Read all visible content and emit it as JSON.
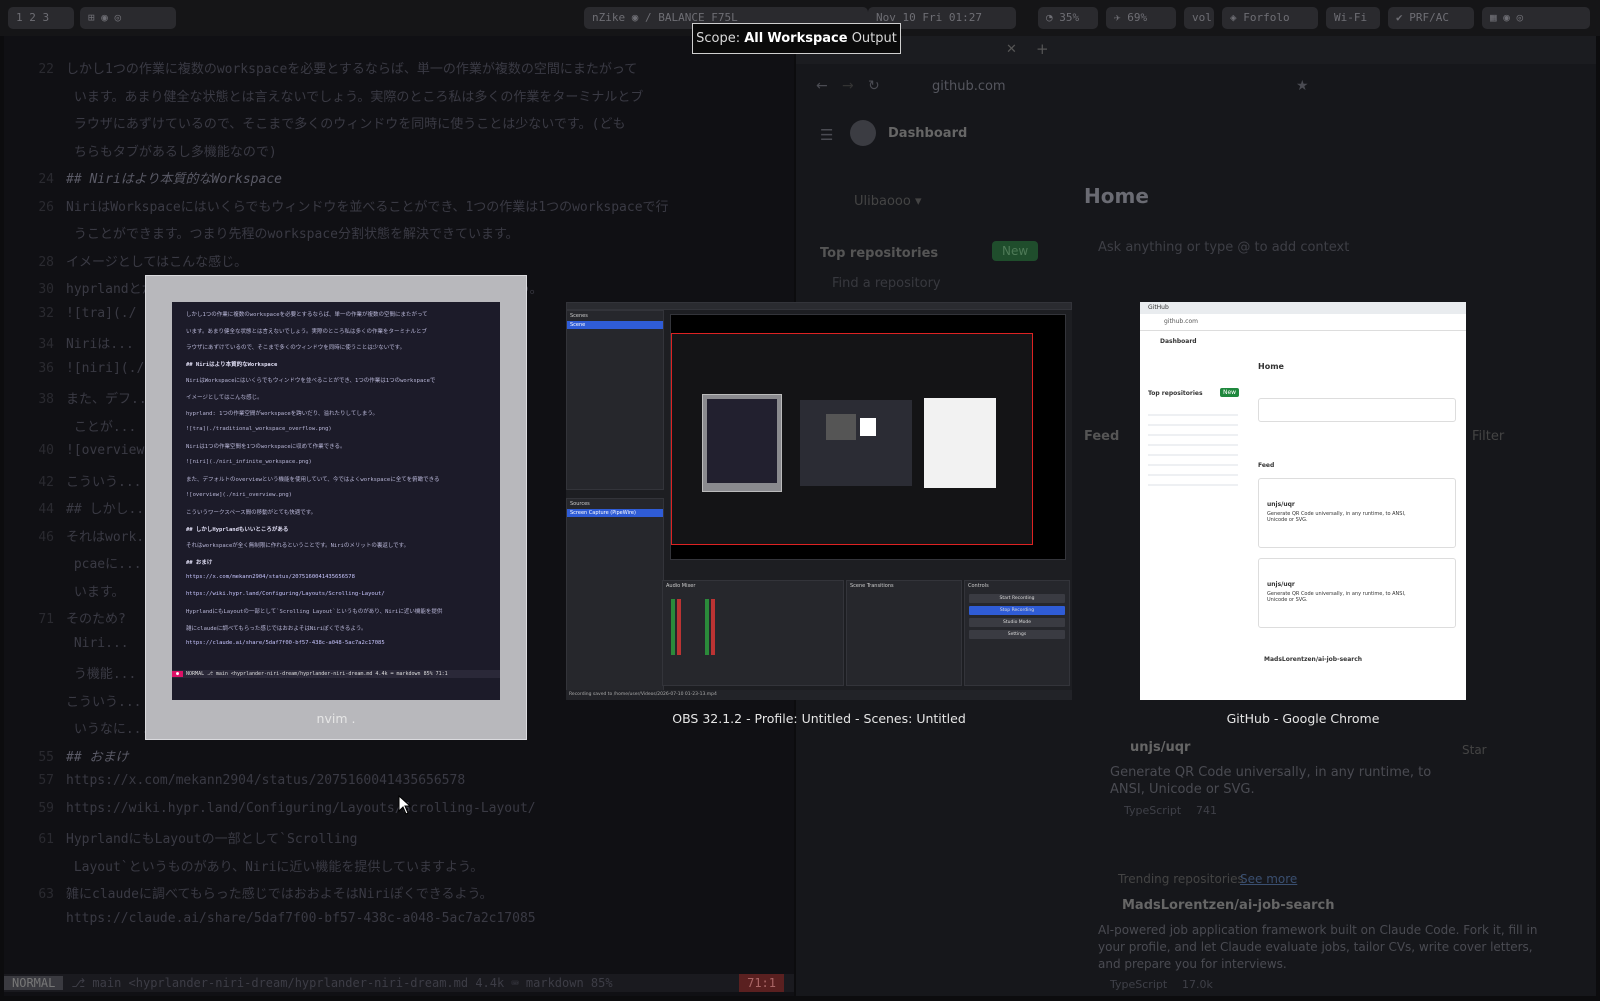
{
  "topbar": {
    "pills": [
      "1 2 3",
      "⊞ ◉ ◎",
      "nZike ◉ / BALANCE F75L",
      "Nov 10 Fri 01:27",
      "◔ 35%",
      "✈ 69%",
      "vol",
      "◈ Forfolo",
      "Wi-Fi",
      "✔ PRF/AC",
      "▦ ◉ ◎"
    ]
  },
  "scope": {
    "label": "Scope:",
    "all": "All",
    "workspace": "Workspace",
    "output": "Output"
  },
  "editor": {
    "lines": [
      {
        "n": "22",
        "t": "しかし1つの作業に複数のworkspaceを必要とするならば、単一の作業が複数の空間にまたがって"
      },
      {
        "n": "",
        "t": "  います。あまり健全な状態とは言えないでしょう。実際のところ私は多くの作業をターミナルとブ"
      },
      {
        "n": "",
        "t": "  ラウザにあずけているので、そこまで多くのウィンドウを同時に使うことは少ないです。(ども"
      },
      {
        "n": "",
        "t": "  ちらもタブがあるし多機能なので)"
      },
      {
        "n": "24",
        "t": "## Niriはより本質的なWorkspace",
        "h": true
      },
      {
        "n": "26",
        "t": "NiriはWorkspaceにはいくらでもウィンドウを並べることができ、1つの作業は1つのworkspaceで行"
      },
      {
        "n": "",
        "t": "  うことができます。つまり先程のworkspace分割状態を解決できています。"
      },
      {
        "n": "28",
        "t": "イメージとしてはこんな感じ。"
      },
      {
        "n": "30",
        "t": "hyprlandとかは1つの作業空間がworkspaceを跨いだり、溢れたりしてしまう。"
      },
      {
        "n": "32",
        "t": "![tra](./"
      },
      {
        "n": "34",
        "t": "Niriは..."
      },
      {
        "n": "36",
        "t": "![niri](./"
      },
      {
        "n": "38",
        "t": "また、デフ..."
      },
      {
        "n": "",
        "t": "  ことが..."
      },
      {
        "n": "40",
        "t": "![overview"
      },
      {
        "n": "42",
        "t": "こういう..."
      },
      {
        "n": "44",
        "t": "## しかし..."
      },
      {
        "n": "46",
        "t": "それはwork..."
      },
      {
        "n": "",
        "t": "  pcaeに..."
      },
      {
        "n": "",
        "t": "  います。"
      },
      {
        "n": "71",
        "t": "そのため?"
      },
      {
        "n": "",
        "t": "  Niri..."
      },
      {
        "n": "",
        "t": "  う機能..."
      },
      {
        "n": "",
        "t": "こういう..."
      },
      {
        "n": "",
        "t": "  いうなに..."
      },
      {
        "n": "55",
        "t": "## おまけ",
        "h": true
      },
      {
        "n": "57",
        "t": "https://x.com/mekann2904/status/2075160041435656578"
      },
      {
        "n": "59",
        "t": "https://wiki.hypr.land/Configuring/Layouts/Scrolling-Layout/"
      },
      {
        "n": "61",
        "t": "HyprlandにもLayoutの一部として`Scrolling"
      },
      {
        "n": "",
        "t": "  Layout`というものがあり、Niriに近い機能を提供していますよう。"
      },
      {
        "n": "63",
        "t": "雑にclaudeに調べてもらった感じではおおよそはNiriぽくできるよう。"
      },
      {
        "n": "",
        "t": "https://claude.ai/share/5daf7f00-bf57-438c-a048-5ac7a2c17085"
      }
    ],
    "status": {
      "mode": "NORMAL",
      "file": "⎇ main  <hyprlander-niri-dream/hyprlander-niri-dream.md   4.4k   ⌨ markdown   85%",
      "pos": "71:1"
    }
  },
  "browser_bg": {
    "url": "github.com",
    "dashboard": "Dashboard",
    "user": "Ulibaooo ▾",
    "top_repos": "Top repositories",
    "new_btn": "New",
    "find_repo": "Find a repository",
    "home": "Home",
    "ask": "Ask anything or type @ to add context",
    "feed": "Feed",
    "filter": "Filter",
    "repo1": "unjs/uqr",
    "repo1_desc": "Generate QR Code universally, in any runtime, to ANSI, Unicode or SVG.",
    "repo1_lang": "TypeScript",
    "repo1_stars": "741",
    "star": "Star",
    "trending": "Trending repositories",
    "see_more": "See more",
    "repo2": "MadsLorentzen/ai-job-search",
    "repo2_desc": "AI-powered job application framework built on Claude Code. Fork it, fill in your profile, and let Claude evaluate jobs, tailor CVs, write cover letters, and prepare you for interviews.",
    "repo2_lang": "TypeScript",
    "repo2_stars": "17.0k"
  },
  "windows": [
    {
      "title": "nvim ."
    },
    {
      "title": "OBS 32.1.2 - Profile: Untitled - Scenes: Untitled"
    },
    {
      "title": "GitHub - Google Chrome"
    }
  ],
  "mini_nvim": {
    "lines": [
      "しかし1つの作業に複数のworkspaceを必要とするならば、単一の作業が複数の空間にまたがって",
      "います。あまり健全な状態とは言えないでしょう。実際のところ私は多くの作業をターミナルとブ",
      "ラウザにあずけているので、そこまで多くのウィンドウを同時に使うことは少ないです。",
      "## Niriはより本質的なWorkspace",
      "NiriはWorkspaceにはいくらでもウィンドウを並べることができ、1つの作業は1つのworkspaceで",
      "イメージとしてはこんな感じ。",
      "hyprland: 1つの作業空間がworkspaceを跨いだり、溢れたりしてしまう。",
      "![tra](./traditional_workspace_overflow.png)",
      "Niriは1つの作業空間を1つのworkspaceに収めて作業できる。",
      "![niri](./niri_infinite_workspace.png)",
      "また、デフォルトのoverviewという機能を使用していて、今ではよくworkspaceに全てを俯瞰できる",
      "![overview](./niri_overview.png)",
      "こういうワークスペース間の移動がとても快適です。",
      "## しかしHyprlandもいいところがある",
      "それはworkspaceが全く無制限に作れるということです。Niriのメリットの裏返しです。",
      "## おまけ",
      "https://x.com/mekann2904/status/2075160041435656578",
      "https://wiki.hypr.land/Configuring/Layouts/Scrolling-Layout/",
      "HyprlandにもLayoutの一部として`Scrolling Layout`というものがあり、Niriに近い機能を提供",
      "雑にclaudeに調べてもらった感じではおおよそはNiriぽくできるよう。",
      "https://claude.ai/share/5daf7f00-bf57-438c-a048-5ac7a2c17085"
    ],
    "status": "NORMAL  ⎇ main  <hyprlander-niri-dream/hyprlander-niri-dream.md  4.4k  ⌨ markdown  85%  71:1"
  },
  "mini_obs": {
    "scenes": "Scenes",
    "scene_item": "Scene",
    "sources": "Sources",
    "source_item": "Screen Capture (PipeWire)",
    "audio_mixer": "Audio Mixer",
    "transitions": "Scene Transitions",
    "controls": "Controls",
    "ctrl_buttons": [
      "Start Recording",
      "Stop Recording",
      "Studio Mode",
      "Settings"
    ],
    "statusbar": "Recording saved to /home/user/Videos/2026-07-10 01-23-13.mp4"
  },
  "mini_chrome": {
    "tab": "GitHub",
    "url": "github.com",
    "dashboard": "Dashboard",
    "home": "Home",
    "feed": "Feed",
    "top_repos": "Top repositories",
    "new_btn": "New",
    "repo": "unjs/uqr",
    "desc": "Generate QR Code universally, in any runtime, to ANSI, Unicode or SVG.",
    "trending": "MadsLorentzen/ai-job-search"
  }
}
